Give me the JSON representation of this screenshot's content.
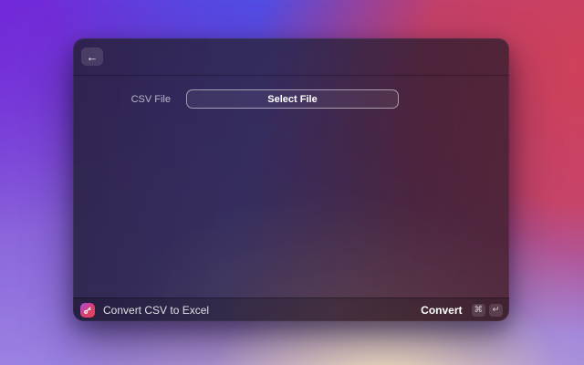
{
  "window": {
    "header": {
      "back_icon": "←"
    },
    "form": {
      "rows": [
        {
          "label": "CSV File",
          "control": {
            "type": "button",
            "label": "Select File"
          }
        }
      ]
    },
    "footer": {
      "extension_icon": "key-icon",
      "command_name": "Convert CSV to Excel",
      "primary_action": {
        "label": "Convert",
        "shortcut_keys": [
          "⌘",
          "↵"
        ]
      }
    }
  },
  "colors": {
    "bg_purple": "#7226d8",
    "bg_blue": "#4753e8",
    "bg_red": "#cf4059",
    "bg_lavender": "#9d86e3",
    "bg_cream_glow": "#f6e4c3",
    "window_tint": "rgba(45,38,72,0.92)",
    "icon_gradient_start": "#b04ae0",
    "icon_gradient_end": "#e8455a"
  }
}
